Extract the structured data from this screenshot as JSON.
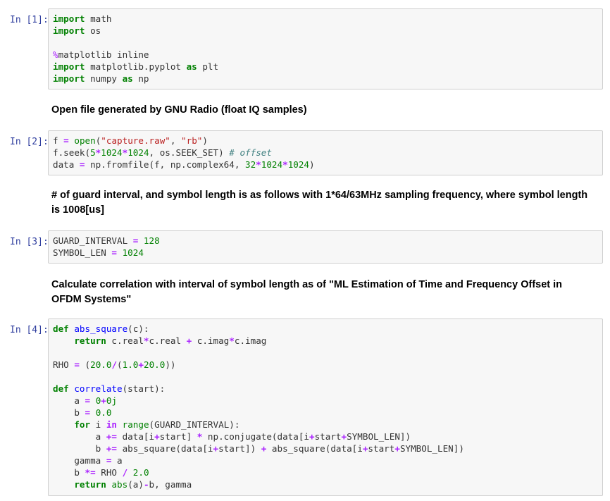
{
  "cells": [
    {
      "prompt": "In [1]:",
      "lines": [
        [
          [
            "kw",
            "import"
          ],
          [
            "t",
            " math"
          ]
        ],
        [
          [
            "kw",
            "import"
          ],
          [
            "t",
            " os"
          ]
        ],
        [],
        [
          [
            "mg",
            "%"
          ],
          [
            "t",
            "matplotlib inline"
          ]
        ],
        [
          [
            "kw",
            "import"
          ],
          [
            "t",
            " matplotlib.pyplot "
          ],
          [
            "kw",
            "as"
          ],
          [
            "t",
            " plt"
          ]
        ],
        [
          [
            "kw",
            "import"
          ],
          [
            "t",
            " numpy "
          ],
          [
            "kw",
            "as"
          ],
          [
            "t",
            " np"
          ]
        ]
      ]
    },
    {
      "markdown": "Open file generated by GNU Radio (float IQ samples)"
    },
    {
      "prompt": "In [2]:",
      "lines": [
        [
          [
            "t",
            "f "
          ],
          [
            "op",
            "="
          ],
          [
            "t",
            " "
          ],
          [
            "bi",
            "open"
          ],
          [
            "t",
            "("
          ],
          [
            "str",
            "\"capture.raw\""
          ],
          [
            "t",
            ", "
          ],
          [
            "str",
            "\"rb\""
          ],
          [
            "t",
            ")"
          ]
        ],
        [
          [
            "t",
            "f.seek("
          ],
          [
            "num",
            "5"
          ],
          [
            "op",
            "*"
          ],
          [
            "num",
            "1024"
          ],
          [
            "op",
            "*"
          ],
          [
            "num",
            "1024"
          ],
          [
            "t",
            ", os.SEEK_SET) "
          ],
          [
            "cm",
            "# offset"
          ]
        ],
        [
          [
            "t",
            "data "
          ],
          [
            "op",
            "="
          ],
          [
            "t",
            " np.fromfile(f, np.complex64, "
          ],
          [
            "num",
            "32"
          ],
          [
            "op",
            "*"
          ],
          [
            "num",
            "1024"
          ],
          [
            "op",
            "*"
          ],
          [
            "num",
            "1024"
          ],
          [
            "t",
            ")"
          ]
        ]
      ]
    },
    {
      "markdown": "# of guard interval, and symbol length is as follows with 1*64/63MHz sampling frequency, where symbol length is 1008[us]"
    },
    {
      "prompt": "In [3]:",
      "lines": [
        [
          [
            "t",
            "GUARD_INTERVAL "
          ],
          [
            "op",
            "="
          ],
          [
            "t",
            " "
          ],
          [
            "num",
            "128"
          ]
        ],
        [
          [
            "t",
            "SYMBOL_LEN "
          ],
          [
            "op",
            "="
          ],
          [
            "t",
            " "
          ],
          [
            "num",
            "1024"
          ]
        ]
      ]
    },
    {
      "markdown": "Calculate correlation with interval of symbol length as of \"ML Estimation of Time and Frequency Offset in OFDM Systems\""
    },
    {
      "prompt": "In [4]:",
      "lines": [
        [
          [
            "kw",
            "def"
          ],
          [
            "t",
            " "
          ],
          [
            "fn",
            "abs_square"
          ],
          [
            "t",
            "(c):"
          ]
        ],
        [
          [
            "t",
            "    "
          ],
          [
            "kw",
            "return"
          ],
          [
            "t",
            " c.real"
          ],
          [
            "op",
            "*"
          ],
          [
            "t",
            "c.real "
          ],
          [
            "op",
            "+"
          ],
          [
            "t",
            " c.imag"
          ],
          [
            "op",
            "*"
          ],
          [
            "t",
            "c.imag"
          ]
        ],
        [],
        [
          [
            "t",
            "RHO "
          ],
          [
            "op",
            "="
          ],
          [
            "t",
            " ("
          ],
          [
            "num",
            "20.0"
          ],
          [
            "op",
            "/"
          ],
          [
            "t",
            "("
          ],
          [
            "num",
            "1.0"
          ],
          [
            "op",
            "+"
          ],
          [
            "num",
            "20.0"
          ],
          [
            "t",
            "))"
          ]
        ],
        [],
        [
          [
            "kw",
            "def"
          ],
          [
            "t",
            " "
          ],
          [
            "fn",
            "correlate"
          ],
          [
            "t",
            "(start):"
          ]
        ],
        [
          [
            "t",
            "    a "
          ],
          [
            "op",
            "="
          ],
          [
            "t",
            " "
          ],
          [
            "num",
            "0"
          ],
          [
            "op",
            "+"
          ],
          [
            "num",
            "0j"
          ]
        ],
        [
          [
            "t",
            "    b "
          ],
          [
            "op",
            "="
          ],
          [
            "t",
            " "
          ],
          [
            "num",
            "0.0"
          ]
        ],
        [
          [
            "t",
            "    "
          ],
          [
            "kw",
            "for"
          ],
          [
            "t",
            " i "
          ],
          [
            "op",
            "in"
          ],
          [
            "t",
            " "
          ],
          [
            "bi",
            "range"
          ],
          [
            "t",
            "(GUARD_INTERVAL):"
          ]
        ],
        [
          [
            "t",
            "        a "
          ],
          [
            "op",
            "+="
          ],
          [
            "t",
            " data[i"
          ],
          [
            "op",
            "+"
          ],
          [
            "t",
            "start] "
          ],
          [
            "op",
            "*"
          ],
          [
            "t",
            " np.conjugate(data[i"
          ],
          [
            "op",
            "+"
          ],
          [
            "t",
            "start"
          ],
          [
            "op",
            "+"
          ],
          [
            "t",
            "SYMBOL_LEN])"
          ]
        ],
        [
          [
            "t",
            "        b "
          ],
          [
            "op",
            "+="
          ],
          [
            "t",
            " abs_square(data[i"
          ],
          [
            "op",
            "+"
          ],
          [
            "t",
            "start]) "
          ],
          [
            "op",
            "+"
          ],
          [
            "t",
            " abs_square(data[i"
          ],
          [
            "op",
            "+"
          ],
          [
            "t",
            "start"
          ],
          [
            "op",
            "+"
          ],
          [
            "t",
            "SYMBOL_LEN])"
          ]
        ],
        [
          [
            "t",
            "    gamma "
          ],
          [
            "op",
            "="
          ],
          [
            "t",
            " a"
          ]
        ],
        [
          [
            "t",
            "    b "
          ],
          [
            "op",
            "*="
          ],
          [
            "t",
            " RHO "
          ],
          [
            "op",
            "/"
          ],
          [
            "t",
            " "
          ],
          [
            "num",
            "2.0"
          ]
        ],
        [
          [
            "t",
            "    "
          ],
          [
            "kw",
            "return"
          ],
          [
            "t",
            " "
          ],
          [
            "bi",
            "abs"
          ],
          [
            "t",
            "(a)"
          ],
          [
            "op",
            "-"
          ],
          [
            "t",
            "b, gamma"
          ]
        ]
      ]
    }
  ]
}
